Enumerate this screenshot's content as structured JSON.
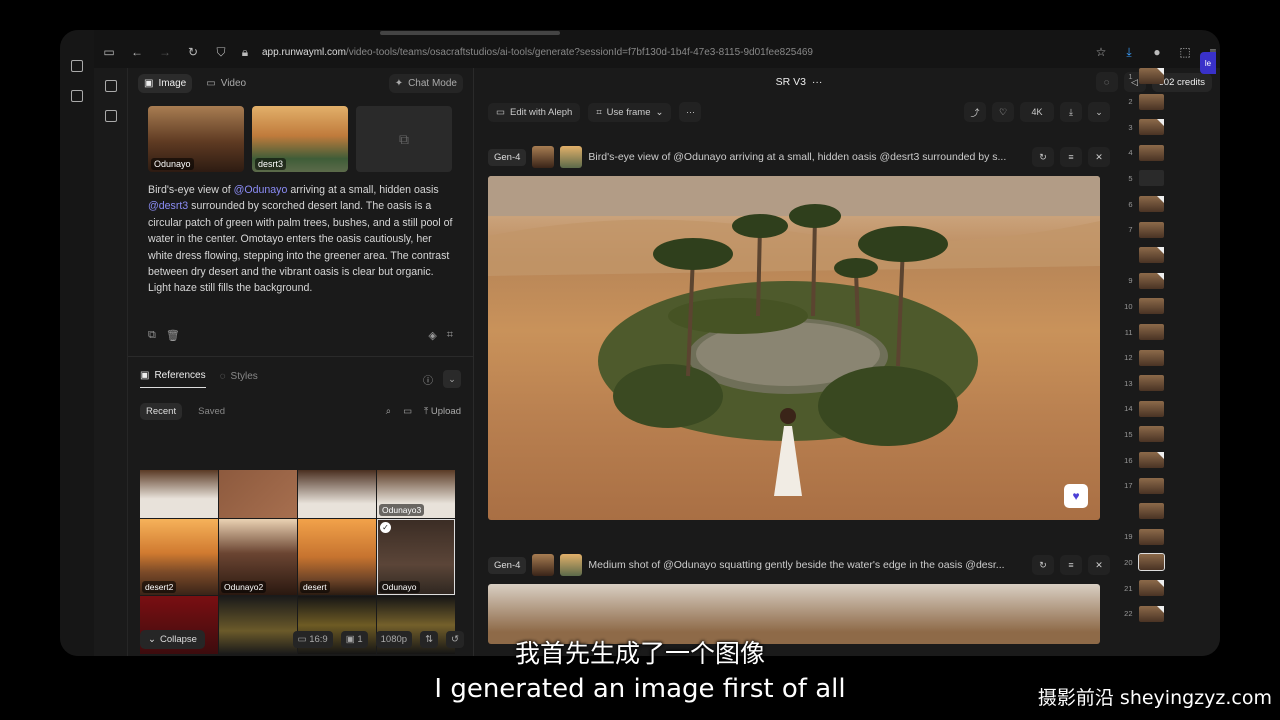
{
  "browser": {
    "url_host": "app.runwayml.com",
    "url_path": "/video-tools/teams/osacraftstudios/ai-tools/generate?sessionId=f7bf130d-1b4f-47e3-8115-9d01fee825469"
  },
  "left": {
    "tabs": [
      {
        "label": "Image",
        "icon": "image-icon",
        "active": true
      },
      {
        "label": "Video",
        "icon": "video-icon",
        "active": false
      }
    ],
    "chat_mode": "Chat Mode",
    "prompt_refs": [
      {
        "label": "Odunayo"
      },
      {
        "label": "desrt3"
      }
    ],
    "prompt": {
      "p1": "Bird's-eye view of ",
      "m1": "@Odunayo",
      "p2": "  arriving at a small, hidden oasis ",
      "m2": "@desrt3",
      "p3": " surrounded by scorched desert land. The oasis is a circular patch of green with palm trees, bushes, and a still pool of water in the center. Omotayo enters the oasis cautiously, her white dress flowing, stepping into the greener area. The contrast between dry desert and the vibrant oasis is clear but organic. Light haze still fills the background."
    },
    "ref_tabs": [
      {
        "label": "References",
        "active": true
      },
      {
        "label": "Styles",
        "active": false
      }
    ],
    "filters": [
      {
        "label": "Recent",
        "active": true
      },
      {
        "label": "Saved",
        "active": false
      }
    ],
    "upload": "Upload",
    "grid_labels": [
      "",
      "",
      "",
      "Odunayo3",
      "desert2",
      "Odunayo2",
      "desert",
      "Odunayo",
      "",
      "",
      "",
      ""
    ],
    "bottom": {
      "collapse": "Collapse",
      "ratio": "16:9",
      "count": "1",
      "res": "1080p"
    }
  },
  "main": {
    "title": "SR V3",
    "tools": {
      "edit": "Edit with Aleph",
      "use_frame": "Use frame",
      "res": "4K"
    },
    "gens": [
      {
        "badge": "Gen-4",
        "text": "Bird's-eye view of @Odunayo arriving at a small, hidden oasis @desrt3 surrounded by s..."
      },
      {
        "badge": "Gen-4",
        "text": "Medium shot of @Odunayo squatting gently beside the water's edge in the oasis @desr..."
      }
    ],
    "credits": "602 credits"
  },
  "strip": {
    "labels": [
      "1",
      "2",
      "3",
      "4",
      "5",
      "6",
      "7",
      "",
      "9",
      "10",
      "11",
      "12",
      "13",
      "14",
      "15",
      "16",
      "17",
      "",
      "19",
      "20",
      "21",
      "22"
    ]
  },
  "subtitles": {
    "cn": "我首先生成了一个图像",
    "en": "I generated an image first of all"
  },
  "watermark": "摄影前沿 sheyingzyz.com"
}
